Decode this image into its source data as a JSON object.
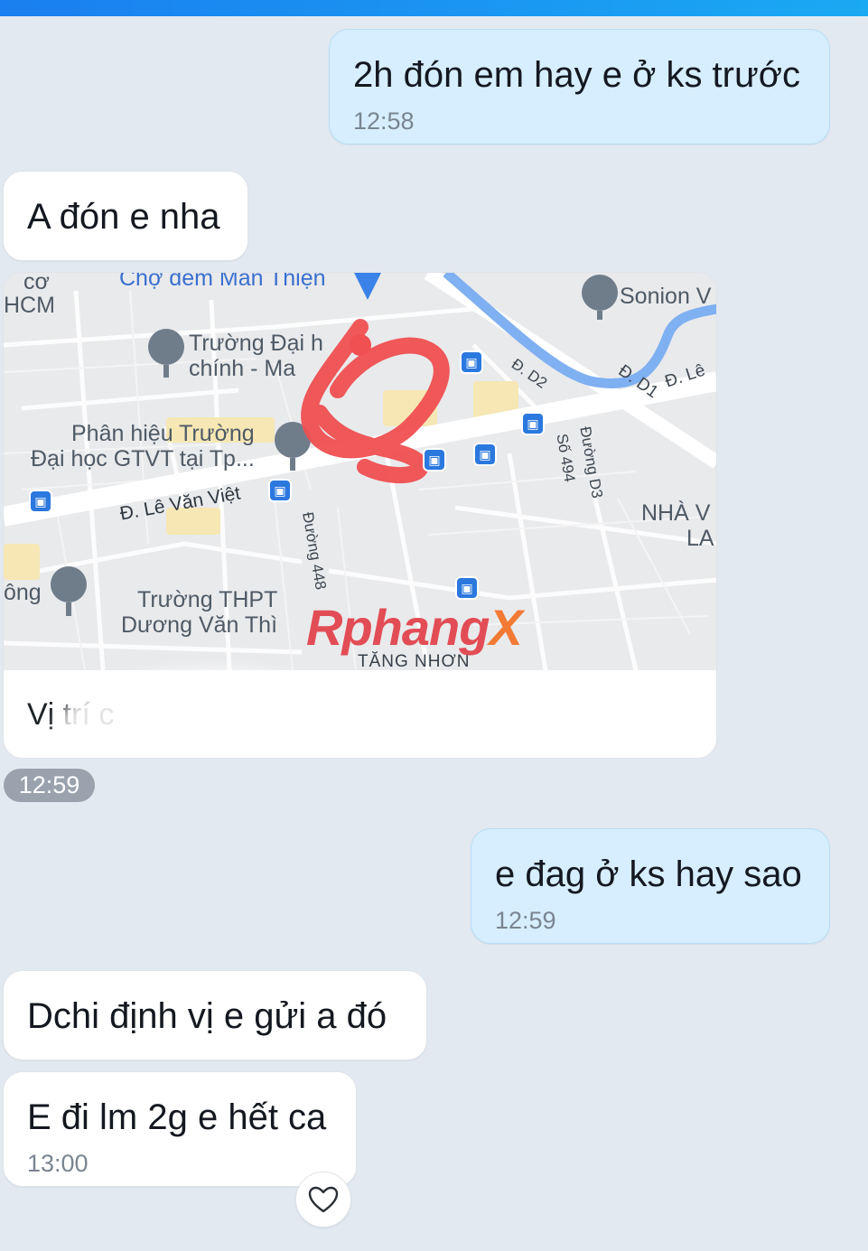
{
  "messages": [
    {
      "text": "2h đón em hay e ở ks trước",
      "time": "12:58"
    },
    {
      "text": "A đón e nha"
    },
    {
      "text": "e đag ở ks hay sao",
      "time": "12:59"
    },
    {
      "text": "Dchi định vị e gửi a đó"
    },
    {
      "text": "E đi lm 2g e hết ca",
      "time": "13:00"
    }
  ],
  "location": {
    "caption": "Vị trí c",
    "time": "12:59",
    "labels": {
      "cho_dem": "Chợ đêm Man Thiện",
      "co": "cơ",
      "hcm": "HCM",
      "truong_dai_1": "Trường Đại h",
      "truong_dai_2": "chính - Ma",
      "phan_hieu_1": "Phân hiệu Trường",
      "phan_hieu_2": "Đại học GTVT tại Tp...",
      "le_van_viet": "Đ. Lê Văn Việt",
      "sonion": "Sonion V",
      "d2": "Đ. D2",
      "d1": "Đ. D1",
      "d_le": "Đ. Lê",
      "duong_d3": "Đường D3",
      "so_494": "Số 494",
      "duong_448": "Đường 448",
      "nha_v": "NHÀ V",
      "la": "LA",
      "ong": "ông",
      "thpt_1": "Trường THPT",
      "thpt_2": "Dương Văn Thì",
      "tang_nhon": "TĂNG NHƠN"
    },
    "watermark_main": "Rphang",
    "watermark_x": "X"
  },
  "colors": {
    "my_bubble": "#d6eeff",
    "their_bubble": "#ffffff",
    "background": "#e2e9f1",
    "bus_icon": "#2b78df"
  }
}
